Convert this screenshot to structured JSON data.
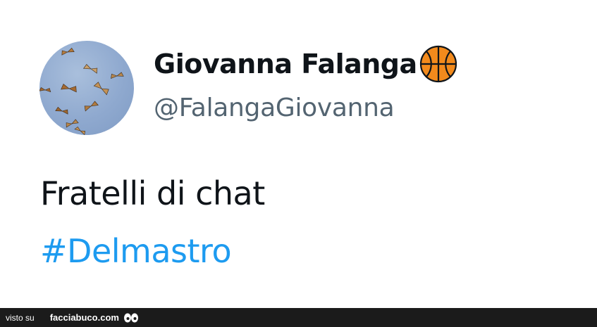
{
  "tweet": {
    "display_name": "Giovanna Falanga",
    "display_name_emoji": "basketball-icon",
    "handle": "@FalangaGiovanna",
    "text": "Fratelli di chat",
    "hashtag": "#Delmastro",
    "avatar_icon": "butterflies-sky-avatar"
  },
  "footer": {
    "visto_su": "visto su",
    "site": "facciabuco.com",
    "logo_icon": "eyes-icon"
  },
  "colors": {
    "name_text": "#0f1419",
    "handle_text": "#536471",
    "hashtag": "#1d9bf0",
    "basketball": "#f28a1c",
    "footer_bg": "#1b1b1b"
  }
}
